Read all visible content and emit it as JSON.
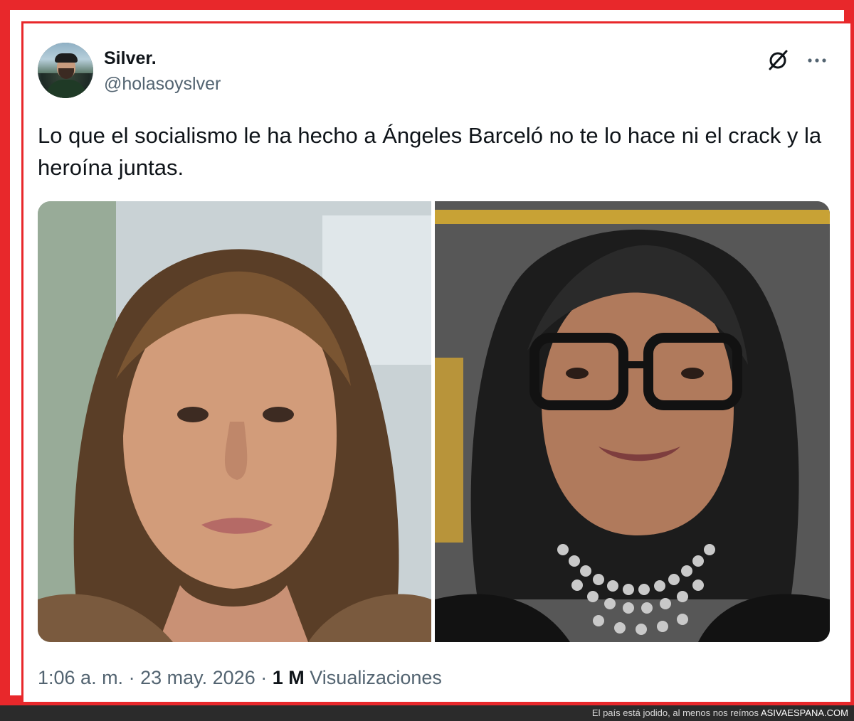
{
  "tweet": {
    "author_name": "Silver.",
    "author_handle": "@holasoyslver",
    "text": "Lo que el socialismo le ha hecho a Ángeles Barceló no te lo hace ni el crack y la heroína juntas.",
    "time": "1:06 a. m.",
    "separator": "·",
    "date": "23 may. 2026",
    "views_count": "1 M",
    "views_label": "Visualizaciones"
  },
  "icons": {
    "grok": "grok-slash-icon",
    "more": "more-dots-icon"
  },
  "footer": {
    "caption": "El país está jodido, al menos nos reímos",
    "brand": "ASIVAESPANA.COM"
  },
  "colors": {
    "frame": "#e8282b",
    "text_primary": "#0f1419",
    "text_secondary": "#536471",
    "footer_bg": "#2b2b2b"
  }
}
